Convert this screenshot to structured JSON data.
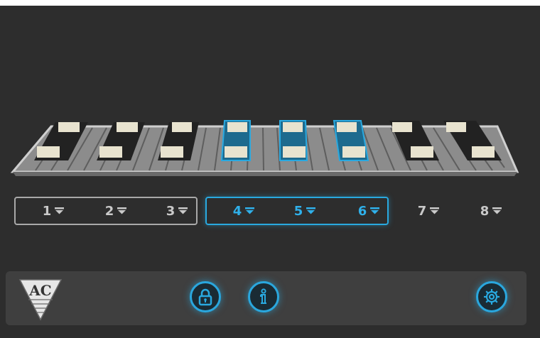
{
  "seats": [
    {
      "number": "1",
      "state": "selected-group-1"
    },
    {
      "number": "2",
      "state": "selected-group-1"
    },
    {
      "number": "3",
      "state": "selected-group-1"
    },
    {
      "number": "4",
      "state": "active"
    },
    {
      "number": "5",
      "state": "active"
    },
    {
      "number": "6",
      "state": "active"
    },
    {
      "number": "7",
      "state": "unselected"
    },
    {
      "number": "8",
      "state": "unselected"
    }
  ],
  "logo_text": "AC",
  "footer_icons": [
    "lock-icon",
    "info-icon",
    "gear-icon"
  ],
  "colors": {
    "background": "#2d2d2d",
    "footer": "#3f3f3f",
    "accent": "#29a9e0",
    "group_border": "#a9a9a9",
    "seat_dark": "#222222",
    "seat_light": "#e8e3cf"
  }
}
